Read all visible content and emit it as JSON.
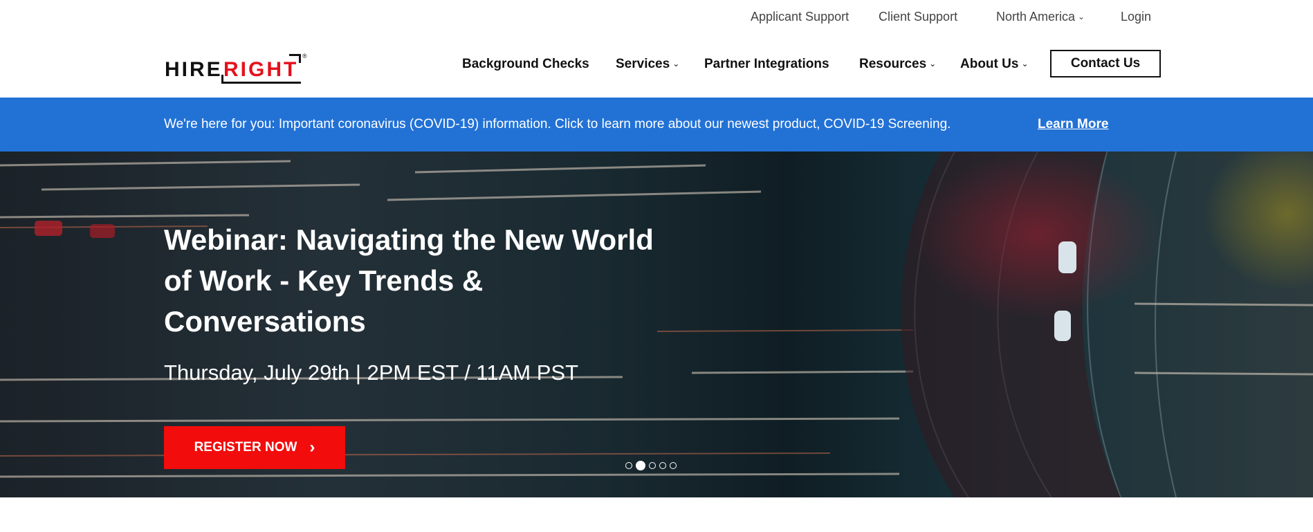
{
  "utility_nav": {
    "applicant_support": "Applicant Support",
    "client_support": "Client Support",
    "region": "North America",
    "login": "Login"
  },
  "logo": {
    "part1": "HIRE",
    "part2": "RIGHT",
    "mark": "®"
  },
  "main_nav": {
    "background_checks": "Background Checks",
    "services": "Services",
    "partner_integrations": "Partner Integrations",
    "resources": "Resources",
    "about_us": "About Us",
    "contact_us": "Contact Us"
  },
  "banner": {
    "message": "We're here for you: Important coronavirus (COVID-19) information. Click to learn more about our newest product, COVID-19 Screening.",
    "link": "Learn More",
    "color": "#2272d6"
  },
  "hero": {
    "title": "Webinar: Navigating the New World of Work - Key Trends & Conversations",
    "subtitle": "Thursday, July 29th | 2PM EST / 11AM PST",
    "cta_label": "REGISTER NOW",
    "cta_color": "#f20c0c",
    "slides_total": 5,
    "active_slide": 2
  },
  "icons": {
    "dropdown": "chevron-down-icon",
    "cta_arrow": "chevron-right-icon"
  }
}
